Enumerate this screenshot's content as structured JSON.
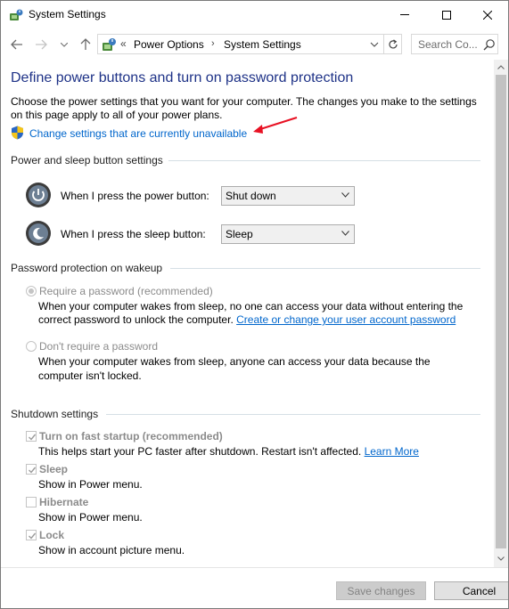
{
  "window": {
    "title": "System Settings",
    "minimize_icon": "minimize-icon",
    "maximize_icon": "maximize-icon",
    "close_icon": "close-icon"
  },
  "navigation": {
    "breadcrumb_sep": "«",
    "breadcrumbs": [
      "Power Options",
      "System Settings"
    ],
    "breadcrumb_arrow": "›",
    "search_placeholder": "Search Co..."
  },
  "page": {
    "title": "Define power buttons and turn on password protection",
    "intro": "Choose the power settings that you want for your computer. The changes you make to the settings on this page apply to all of your power plans.",
    "unavailable_link": "Change settings that are currently unavailable"
  },
  "power_sleep": {
    "header": "Power and sleep button settings",
    "power_label": "When I press the power button:",
    "power_value": "Shut down",
    "sleep_label": "When I press the sleep button:",
    "sleep_value": "Sleep"
  },
  "password": {
    "header": "Password protection on wakeup",
    "require_label": "Require a password (recommended)",
    "require_desc_1": "When your computer wakes from sleep, no one can access your data without entering the",
    "require_desc_2": "correct password to unlock the computer.",
    "require_link": "Create or change your user account password",
    "norequire_label": "Don't require a password",
    "norequire_desc": "When your computer wakes from sleep, anyone can access your data because the computer isn't locked.",
    "require_checked": true
  },
  "shutdown": {
    "header": "Shutdown settings",
    "items": [
      {
        "label": "Turn on fast startup (recommended)",
        "desc": "This helps start your PC faster after shutdown. Restart isn't affected.",
        "link": "Learn More",
        "checked": true
      },
      {
        "label": "Sleep",
        "desc": "Show in Power menu.",
        "checked": true
      },
      {
        "label": "Hibernate",
        "desc": "Show in Power menu.",
        "checked": false
      },
      {
        "label": "Lock",
        "desc": "Show in account picture menu.",
        "checked": true
      }
    ]
  },
  "footer": {
    "save_label": "Save changes",
    "cancel_label": "Cancel"
  },
  "colors": {
    "title_blue": "#1e3287",
    "link_blue": "#0066cc",
    "arrow_red": "#e81123"
  }
}
